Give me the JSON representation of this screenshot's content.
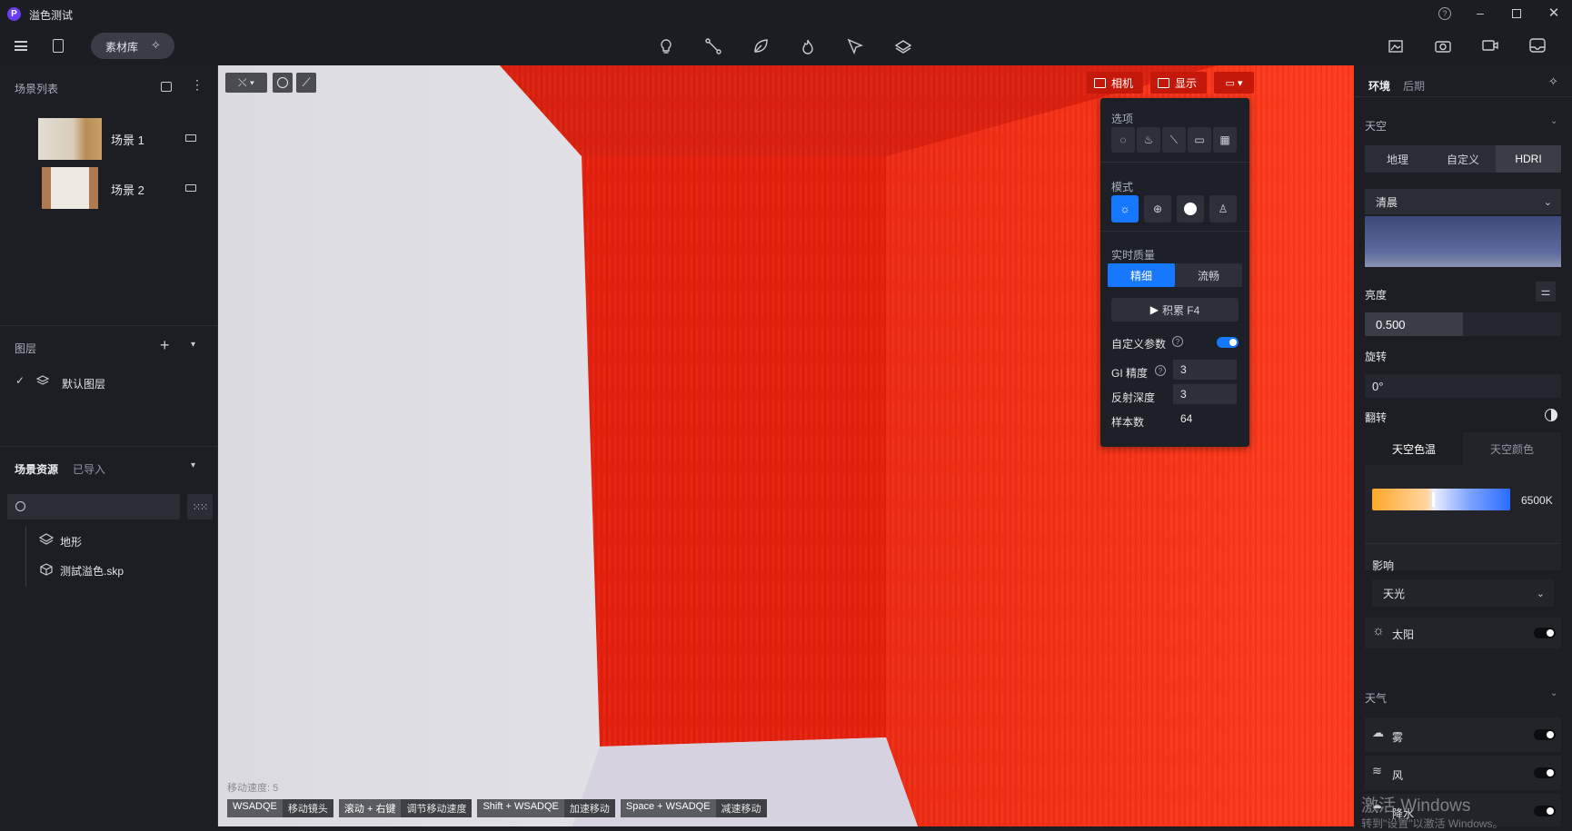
{
  "window": {
    "title": "溢色测试",
    "app_logo": "P"
  },
  "toolbar": {
    "asset_library": "素材库"
  },
  "left": {
    "scene_list_title": "场景列表",
    "scenes": [
      {
        "label": "场景 1"
      },
      {
        "label": "场景 2"
      }
    ],
    "layers_title": "图层",
    "default_layer": "默认图层",
    "assets_tab_scene": "场景资源",
    "assets_tab_imported": "已导入",
    "search_placeholder": "",
    "tree": [
      {
        "label": "地形"
      },
      {
        "label": "测試溢色.skp"
      }
    ]
  },
  "viewport": {
    "camera_btn": "相机",
    "display_btn": "显示",
    "move_speed": "移动速度: 5",
    "hints": [
      {
        "key": "WSADQE",
        "val": "移动镜头"
      },
      {
        "key": "滚动 + 右键",
        "val": "调节移动速度"
      },
      {
        "key": "Shift + WSADQE",
        "val": "加速移动"
      },
      {
        "key": "Space + WSADQE",
        "val": "减速移动"
      }
    ]
  },
  "display_panel": {
    "options_title": "选项",
    "mode_title": "模式",
    "quality_title": "实时质量",
    "quality_fine": "精细",
    "quality_smooth": "流畅",
    "accumulate": "积累 F4",
    "custom_params": "自定义参数",
    "gi_label": "GI 精度",
    "gi_value": "3",
    "reflect_label": "反射深度",
    "reflect_value": "3",
    "samples_label": "样本数",
    "samples_value": "64"
  },
  "right": {
    "tab_env": "环境",
    "tab_post": "后期",
    "sky_title": "天空",
    "sky_tabs": [
      "地理",
      "自定义",
      "HDRI"
    ],
    "preset": "清晨",
    "brightness_label": "亮度",
    "brightness_value": "0.500",
    "brightness_level": 0.5,
    "rotation_label": "旋转",
    "rotation_value": "0°",
    "flip_label": "翻转",
    "color_tab_temp": "天空色温",
    "color_tab_color": "天空颜色",
    "temp_value": "6500K",
    "influence_label": "影响",
    "influence_value": "天光",
    "sun_label": "太阳",
    "weather_title": "天气",
    "fog_label": "雾",
    "wind_label": "风",
    "rain_label": "降水",
    "watermark_1": "激活 Windows",
    "watermark_2": "转到\"设置\"以激活 Windows。"
  },
  "colors": {
    "accent": "#1677ff",
    "red_wall": "#e8200e",
    "bg": "#1c1e24"
  }
}
